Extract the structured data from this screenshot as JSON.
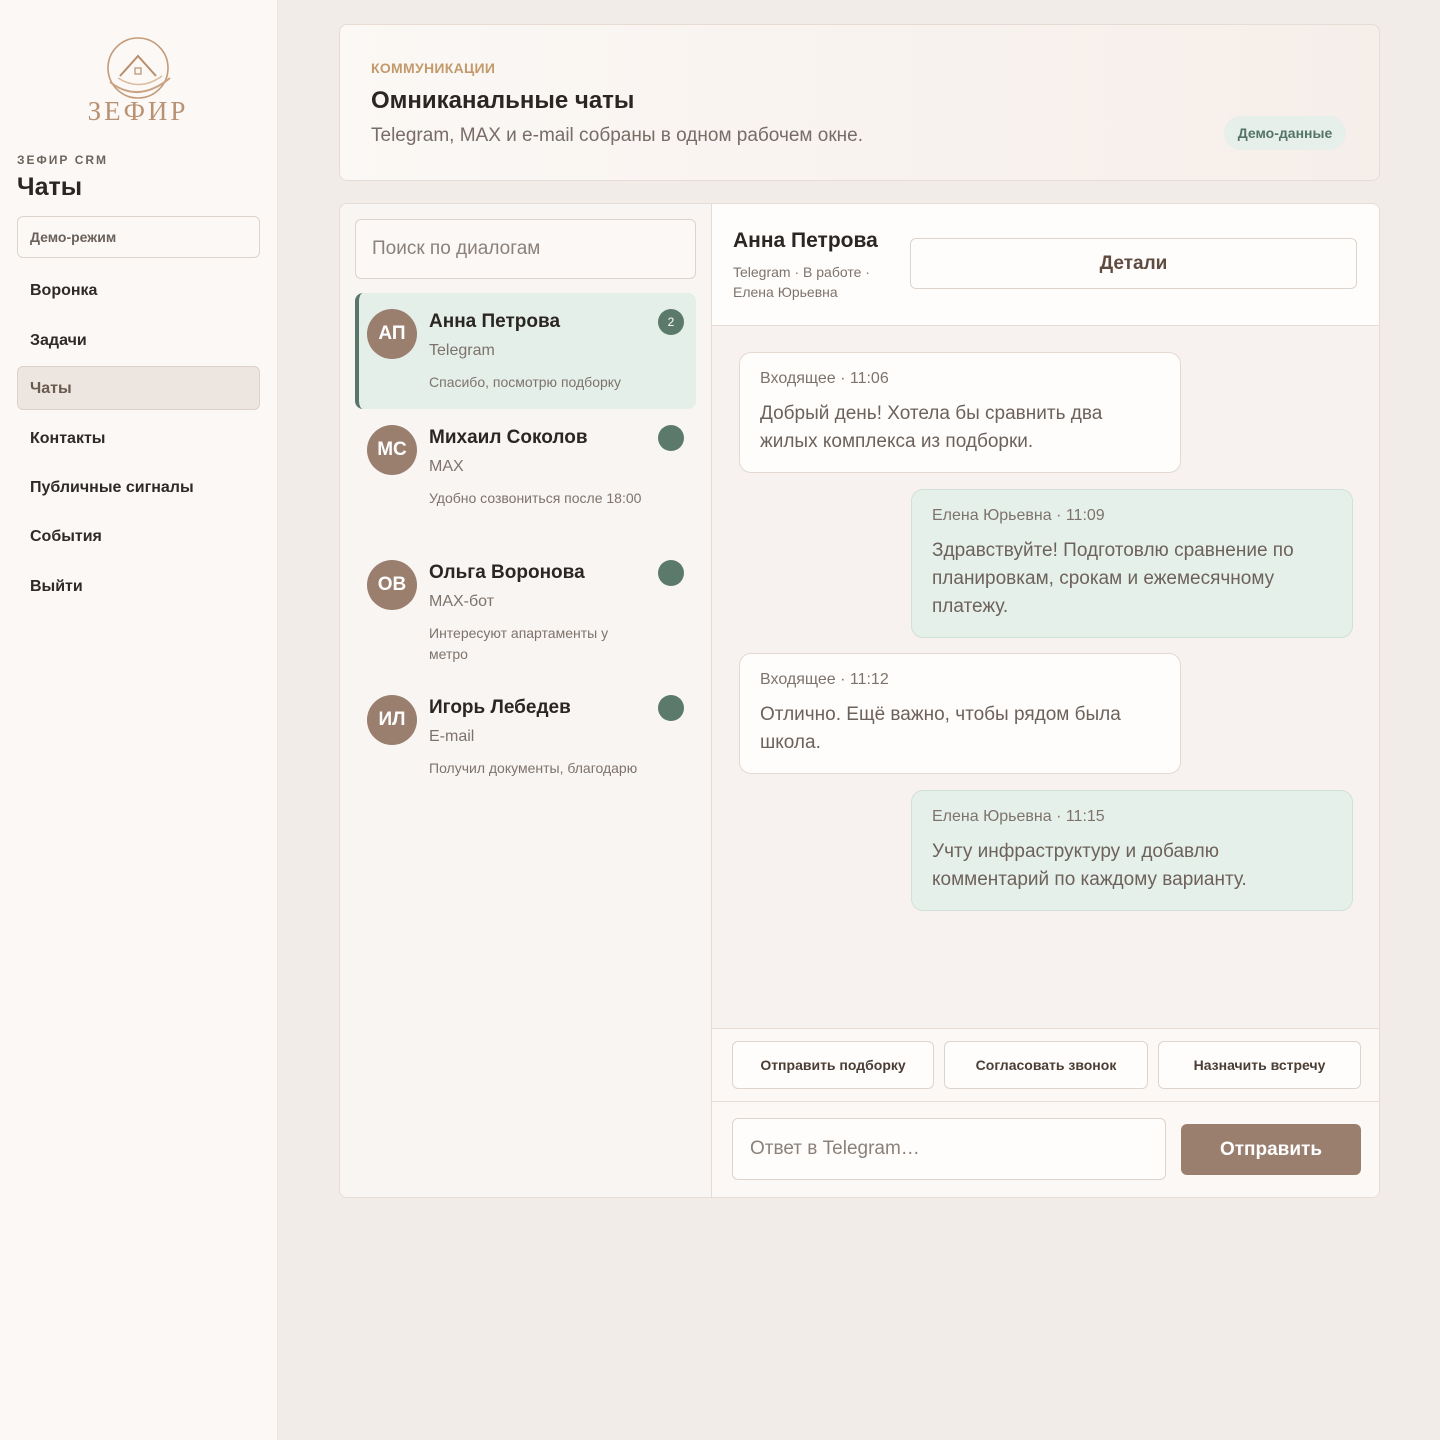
{
  "sidebar": {
    "logo_text": "ЗЕФИР",
    "brand_label": "ЗЕФИР CRM",
    "title": "Чаты",
    "demo_mode": "Демо-режим",
    "nav": [
      "Воронка",
      "Задачи",
      "Чаты",
      "Контакты",
      "Публичные сигналы",
      "События",
      "Выйти"
    ],
    "active_nav": "Чаты"
  },
  "header": {
    "eyebrow": "КОММУНИКАЦИИ",
    "title": "Омниканальные чаты",
    "subtitle": "Telegram, MAX и e-mail собраны в одном рабочем окне.",
    "badge": "Демо-данные"
  },
  "dialogs": {
    "search_placeholder": "Поиск по диалогам",
    "items": [
      {
        "initials": "АП",
        "name": "Анна Петрова",
        "channel": "Telegram",
        "preview": "Спасибо, посмотрю подборку",
        "badge": "2"
      },
      {
        "initials": "МС",
        "name": "Михаил Соколов",
        "channel": "MAX",
        "preview": "Удобно созвониться после 18:00",
        "badge": ""
      },
      {
        "initials": "ОВ",
        "name": "Ольга Воронова",
        "channel": "MAX-бот",
        "preview": "Интересуют апартаменты у метро",
        "badge": ""
      },
      {
        "initials": "ИЛ",
        "name": "Игорь Лебедев",
        "channel": "E-mail",
        "preview": "Получил документы, благодарю",
        "badge": ""
      }
    ]
  },
  "conversation": {
    "name": "Анна Петрова",
    "meta": "Telegram · В работе · Елена Юрьевна",
    "details_label": "Детали",
    "messages": [
      {
        "direction": "in",
        "meta": "Входящее · 11:06",
        "text": "Добрый день! Хотела бы сравнить два жилых комплекса из подборки."
      },
      {
        "direction": "out",
        "meta": "Елена Юрьевна · 11:09",
        "text": "Здравствуйте! Подготовлю сравнение по планировкам, срокам и ежемесячному платежу."
      },
      {
        "direction": "in",
        "meta": "Входящее · 11:12",
        "text": "Отлично. Ещё важно, чтобы рядом была школа."
      },
      {
        "direction": "out",
        "meta": "Елена Юрьевна · 11:15",
        "text": "Учту инфраструктуру и добавлю комментарий по каждому варианту."
      }
    ],
    "quick_replies": [
      "Отправить подборку",
      "Согласовать звонок",
      "Назначить встречу"
    ],
    "reply_placeholder": "Ответ в Telegram…",
    "send_label": "Отправить"
  },
  "colors": {
    "accent": "#9a7e6e",
    "status_green": "#5c7a6c",
    "eyebrow": "#c39a6c"
  }
}
